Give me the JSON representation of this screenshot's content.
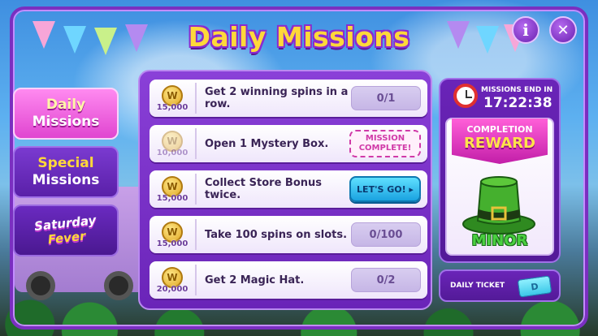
{
  "title": "Daily Missions",
  "header": {
    "info_icon": "info-icon",
    "info_glyph": "i",
    "close_icon": "close-icon",
    "close_glyph": "✕"
  },
  "tabs": [
    {
      "line1": "Daily",
      "line2": "Missions",
      "active": true
    },
    {
      "line1": "Special",
      "line2": "Missions",
      "active": false
    },
    {
      "logo_line1": "Saturday",
      "logo_line2": "Fever",
      "active": false
    }
  ],
  "missions": [
    {
      "reward": "15,000",
      "text": "Get 2 winning spins in a row.",
      "status": "progress",
      "progress": "0/1"
    },
    {
      "reward": "10,000",
      "text": "Open 1 Mystery Box.",
      "status": "complete",
      "badge_line1": "MISSION",
      "badge_line2": "COMPLETE!"
    },
    {
      "reward": "15,000",
      "text": "Collect Store Bonus twice.",
      "status": "go",
      "button": "LET'S GO! ▸"
    },
    {
      "reward": "15,000",
      "text": "Take 100 spins on slots.",
      "status": "progress",
      "progress": "0/100"
    },
    {
      "reward": "20,000",
      "text": "Get 2 Magic Hat.",
      "status": "progress",
      "progress": "0/2"
    }
  ],
  "coin_glyph": "W",
  "timer": {
    "label": "MISSIONS END IN",
    "time": "17:22:38"
  },
  "reward": {
    "line1": "COMPLETION",
    "line2": "REWARD",
    "tier": "MINOR",
    "icon": "green-top-hat-icon"
  },
  "ticket": {
    "label": "DAILY TICKET",
    "icon": "ticket-icon"
  },
  "colors": {
    "accent_purple": "#7a2fc0",
    "title_yellow": "#ffd83a",
    "go_blue": "#1aa2e0",
    "complete_pink": "#d03aa8",
    "minor_green": "#4ad040"
  }
}
